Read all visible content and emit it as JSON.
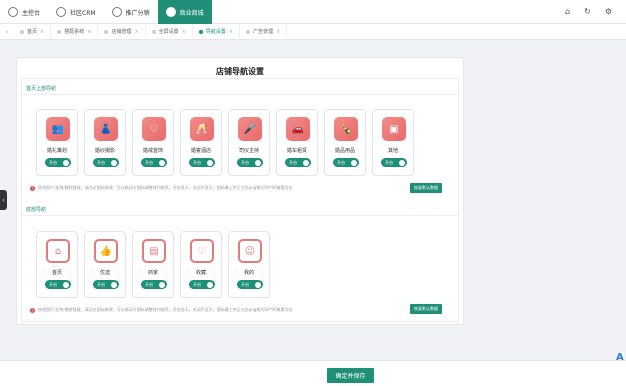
{
  "top_tabs": [
    {
      "label": "主控台",
      "icon": "home-circle-icon"
    },
    {
      "label": "社区CRM",
      "icon": "crm-icon"
    },
    {
      "label": "推广分销",
      "icon": "share-icon"
    },
    {
      "label": "商业商城",
      "icon": "shop-icon"
    }
  ],
  "top_right": {
    "home": "⌂",
    "refresh": "↻",
    "settings": "⚙"
  },
  "nav_tabs": [
    "首页",
    "搭配系统",
    "店铺管理",
    "全屏设置",
    "导航设置",
    "广告管理"
  ],
  "card": {
    "title": "店铺导航设置",
    "top_section": {
      "title": "首页上部导航",
      "items": [
        {
          "label": "婚礼策划",
          "toggle": "开启"
        },
        {
          "label": "婚纱摄影",
          "toggle": "开启"
        },
        {
          "label": "婚戒首饰",
          "toggle": "开启"
        },
        {
          "label": "婚宴酒店",
          "toggle": "开启"
        },
        {
          "label": "司仪主持",
          "toggle": "开启"
        },
        {
          "label": "婚车租赁",
          "toggle": "开启"
        },
        {
          "label": "婚品用品",
          "toggle": "开启"
        },
        {
          "label": "其他",
          "toggle": "开启"
        }
      ],
      "notice": "修改图片/名称/跳转链接，请点击图标修改；可以拖动卡图标调整排列顺序，开启显示，关闭不显示；图标最上传正方形png格式90*90像素为佳",
      "button": "恢复默认数据"
    },
    "bottom_section": {
      "title": "底部导航",
      "items": [
        {
          "label": "首页",
          "toggle": "开启"
        },
        {
          "label": "优选",
          "toggle": "开启"
        },
        {
          "label": "商家",
          "toggle": "开启"
        },
        {
          "label": "收藏",
          "toggle": "开启"
        },
        {
          "label": "我的",
          "toggle": "开启"
        }
      ],
      "notice": "修改图片/名称/跳转链接，请点击图标修改；可以拖动卡图标调整排列顺序，开启显示，关闭不显示；图标最上传正方形png格式90*90像素为佳",
      "button": "恢复默认数据"
    }
  },
  "footer": {
    "save_label": "确定并保存"
  },
  "colors": {
    "accent": "#1f8f78",
    "icon_red": "#e86a6a"
  }
}
